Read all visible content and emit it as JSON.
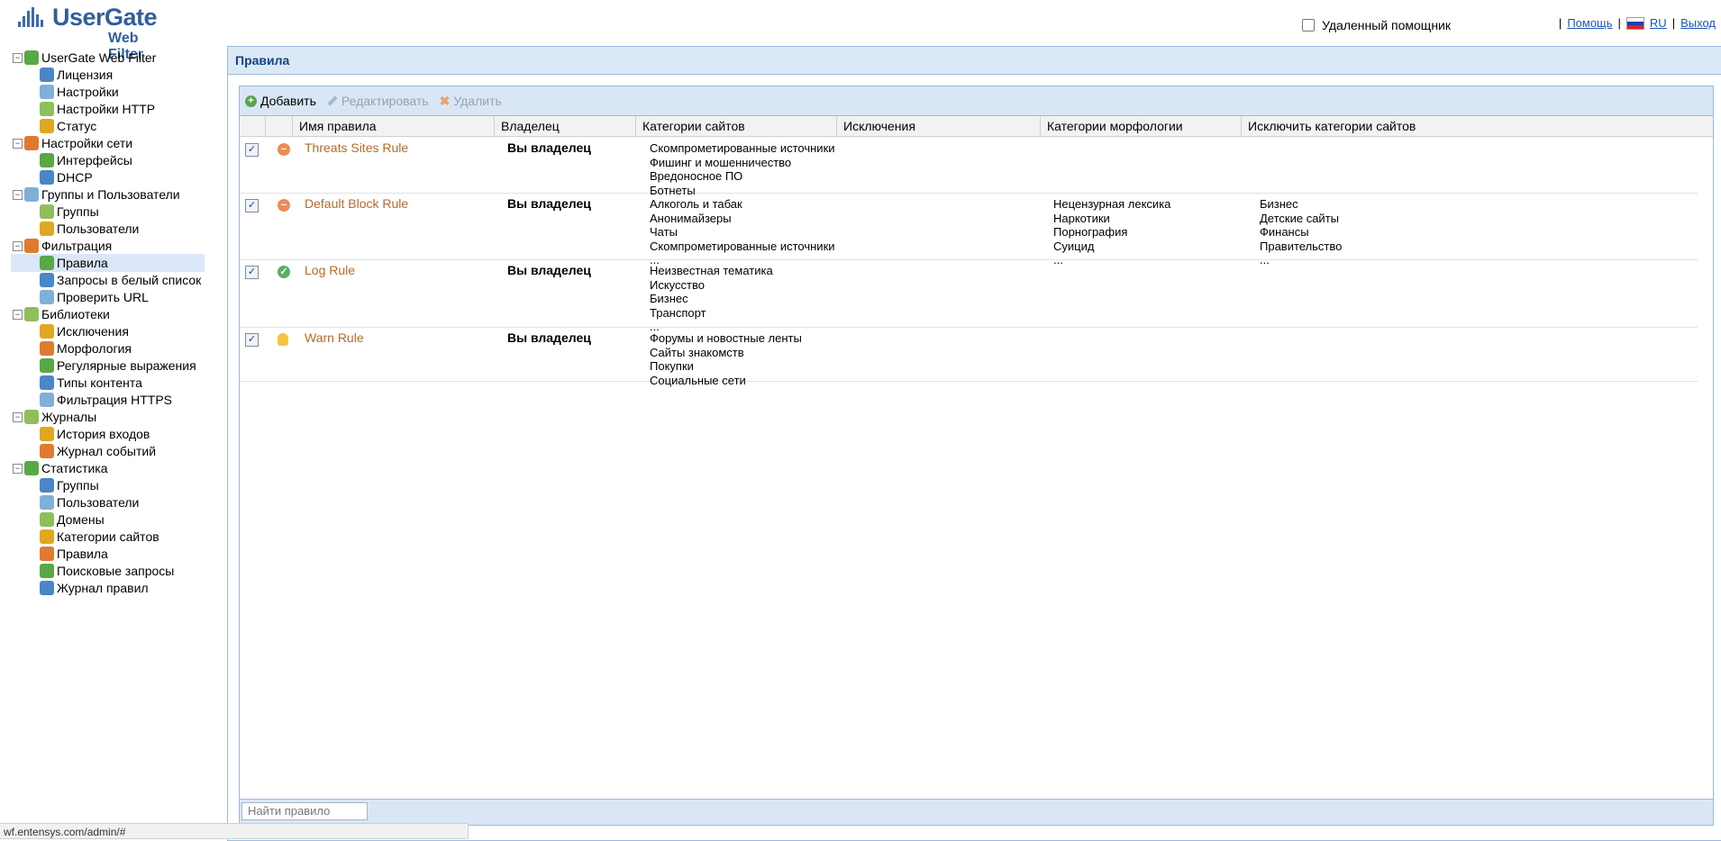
{
  "logo": {
    "brand": "UserGate",
    "sub": "Web Filter"
  },
  "top": {
    "remote_label": "Удаленный помощник",
    "help": "Помощь",
    "lang": "RU",
    "logout": "Выход"
  },
  "sidebar": {
    "items": [
      {
        "label": "UserGate Web Filter",
        "level": 0,
        "icon": "globe-icon"
      },
      {
        "label": "Лицензия",
        "level": 1,
        "icon": "info-icon"
      },
      {
        "label": "Настройки",
        "level": 1,
        "icon": "settings-icon"
      },
      {
        "label": "Настройки HTTP",
        "level": 1,
        "icon": "http-settings-icon"
      },
      {
        "label": "Статус",
        "level": 1,
        "icon": "chart-icon"
      },
      {
        "label": "Настройки сети",
        "level": 0,
        "icon": "tools-icon"
      },
      {
        "label": "Интерфейсы",
        "level": 1,
        "icon": "network-icon"
      },
      {
        "label": "DHCP",
        "level": 1,
        "icon": "dhcp-icon"
      },
      {
        "label": "Группы и Пользователи",
        "level": 0,
        "icon": "users-folder-icon"
      },
      {
        "label": "Группы",
        "level": 1,
        "icon": "group-icon"
      },
      {
        "label": "Пользователи",
        "level": 1,
        "icon": "user-icon"
      },
      {
        "label": "Фильтрация",
        "level": 0,
        "icon": "filter-icon"
      },
      {
        "label": "Правила",
        "level": 1,
        "icon": "rules-icon",
        "selected": true
      },
      {
        "label": "Запросы в белый список",
        "level": 1,
        "icon": "checkmark-icon"
      },
      {
        "label": "Проверить URL",
        "level": 1,
        "icon": "check-url-icon"
      },
      {
        "label": "Библиотеки",
        "level": 0,
        "icon": "books-icon"
      },
      {
        "label": "Исключения",
        "level": 1,
        "icon": "exceptions-icon"
      },
      {
        "label": "Морфология",
        "level": 1,
        "icon": "morphology-icon"
      },
      {
        "label": "Регулярные выражения",
        "level": 1,
        "icon": "regex-icon"
      },
      {
        "label": "Типы контента",
        "level": 1,
        "icon": "content-types-icon"
      },
      {
        "label": "Фильтрация HTTPS",
        "level": 1,
        "icon": "https-icon"
      },
      {
        "label": "Журналы",
        "level": 0,
        "icon": "journal-icon"
      },
      {
        "label": "История входов",
        "level": 1,
        "icon": "login-history-icon"
      },
      {
        "label": "Журнал событий",
        "level": 1,
        "icon": "events-log-icon"
      },
      {
        "label": "Статистика",
        "level": 0,
        "icon": "stats-icon"
      },
      {
        "label": "Группы",
        "level": 1,
        "icon": "group-icon"
      },
      {
        "label": "Пользователи",
        "level": 1,
        "icon": "user-icon"
      },
      {
        "label": "Домены",
        "level": 1,
        "icon": "domains-icon"
      },
      {
        "label": "Категории сайтов",
        "level": 1,
        "icon": "categories-icon"
      },
      {
        "label": "Правила",
        "level": 1,
        "icon": "rules-stat-icon"
      },
      {
        "label": "Поисковые запросы",
        "level": 1,
        "icon": "search-queries-icon"
      },
      {
        "label": "Журнал правил",
        "level": 1,
        "icon": "rules-log-icon"
      }
    ]
  },
  "panel": {
    "title": "Правила",
    "toolbar": {
      "add": "Добавить",
      "edit": "Редактировать",
      "delete": "Удалить"
    },
    "columns": [
      "Имя правила",
      "Владелец",
      "Категории сайтов",
      "Исключения",
      "Категории морфологии",
      "Исключить категории сайтов"
    ],
    "rows": [
      {
        "name": "Threats Sites Rule",
        "status": "block",
        "owner": "Вы владелец",
        "categories": [
          "Скомпрометированные источники",
          "Фишинг и мошенничество",
          "Вредоносное ПО",
          "Ботнеты"
        ],
        "morphology": [],
        "exclude": []
      },
      {
        "name": "Default Block Rule",
        "status": "block",
        "owner": "Вы владелец",
        "categories": [
          "Алкоголь и табак",
          "Анонимайзеры",
          "Чаты",
          "Скомпрометированные источники",
          "..."
        ],
        "morphology": [
          "Нецензурная лексика",
          "Наркотики",
          "Порнография",
          "Суицид",
          "..."
        ],
        "exclude": [
          "Бизнес",
          "Детские сайты",
          "Финансы",
          "Правительство",
          "..."
        ]
      },
      {
        "name": "Log Rule",
        "status": "log",
        "owner": "Вы владелец",
        "categories": [
          "Неизвестная тематика",
          "Искусство",
          "Бизнес",
          "Транспорт",
          "..."
        ],
        "morphology": [],
        "exclude": []
      },
      {
        "name": "Warn Rule",
        "status": "warn",
        "owner": "Вы владелец",
        "categories": [
          "Форумы и новостные ленты",
          "Сайты знакомств",
          "Покупки",
          "Социальные сети"
        ],
        "morphology": [],
        "exclude": []
      }
    ],
    "search_placeholder": "Найти правило"
  },
  "statusbar": "wf.entensys.com/admin/#"
}
